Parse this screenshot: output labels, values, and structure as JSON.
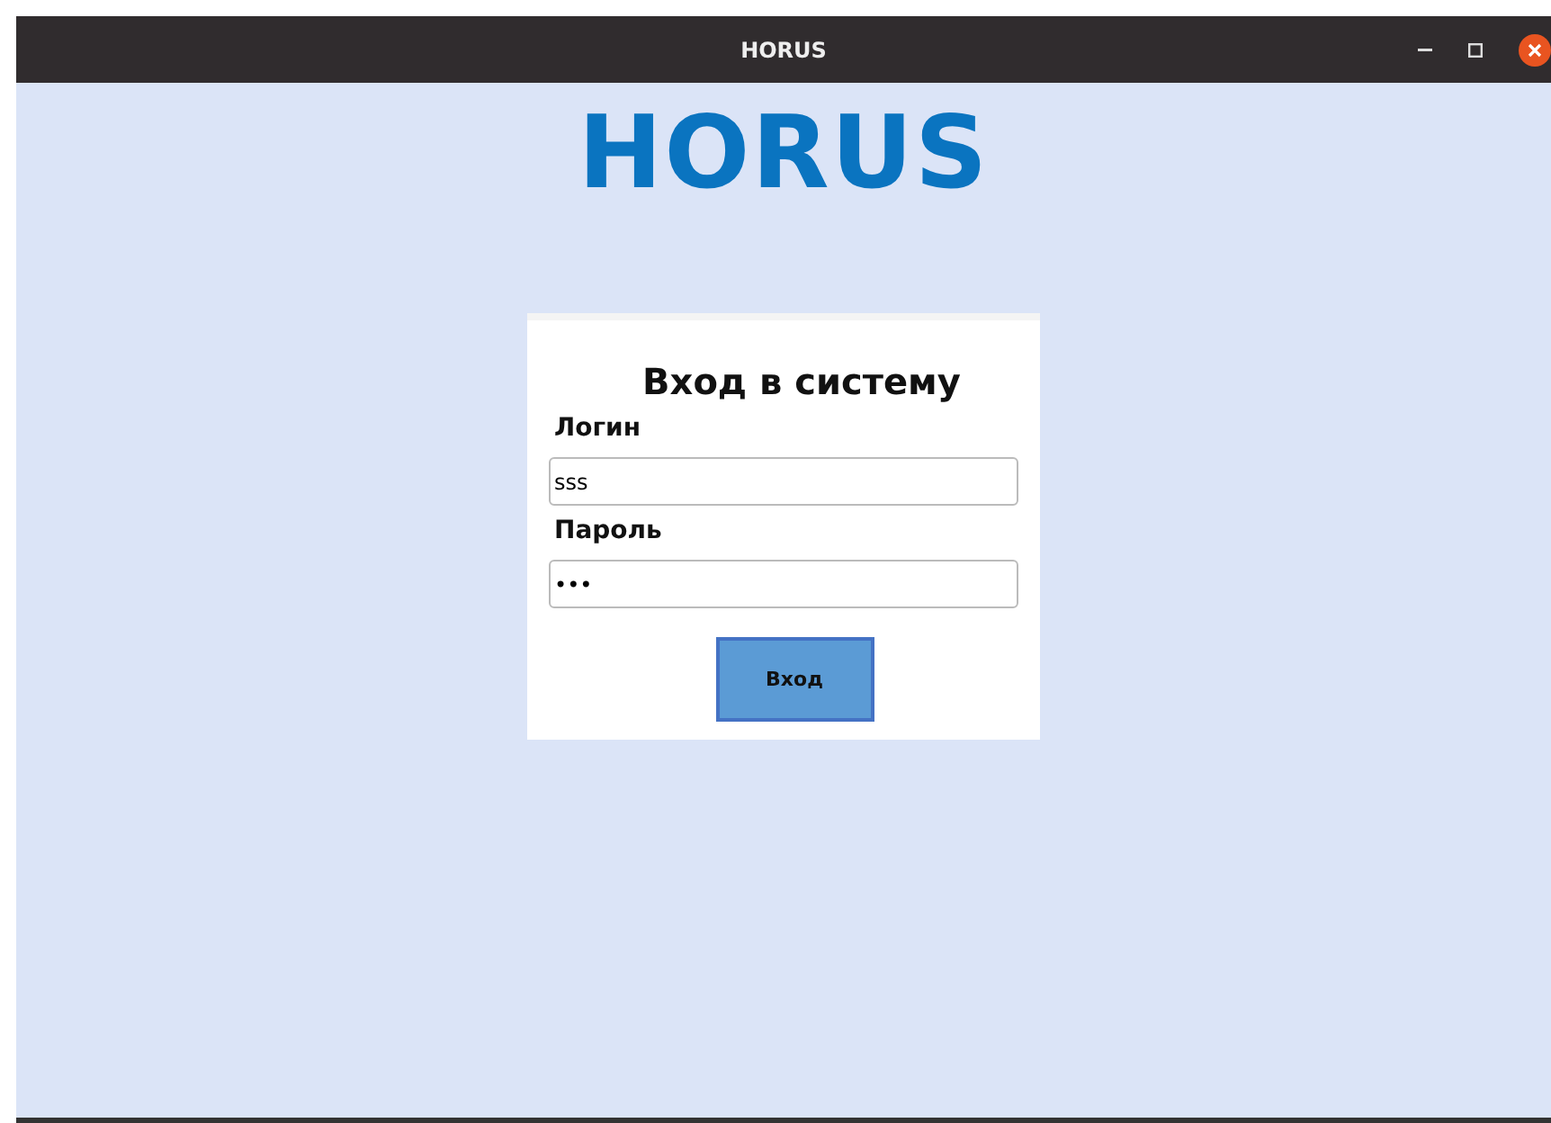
{
  "window": {
    "title": "HORUS"
  },
  "logo": "HORUS",
  "login_form": {
    "title": "Вход в систему",
    "fields": [
      {
        "label": "Логин",
        "value": "sss"
      },
      {
        "label": "Пароль",
        "value": "•••"
      }
    ],
    "submit_button": "Вход"
  }
}
